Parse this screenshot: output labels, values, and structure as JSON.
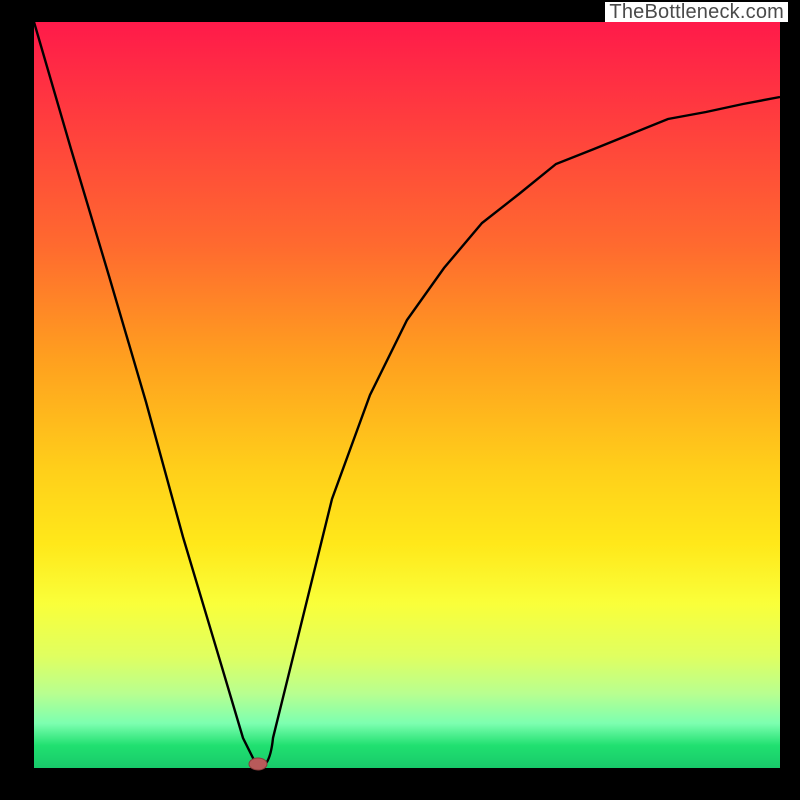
{
  "watermark": "TheBottleneck.com",
  "colors": {
    "frame": "#000000",
    "curve": "#000000",
    "marker": "#b85a5a",
    "gradient_top": "#ff1a4a",
    "gradient_bottom": "#18c96a"
  },
  "chart_data": {
    "type": "line",
    "title": "",
    "xlabel": "",
    "ylabel": "",
    "xlim": [
      0,
      100
    ],
    "ylim": [
      0,
      100
    ],
    "grid": false,
    "legend": false,
    "series": [
      {
        "name": "bottleneck-curve",
        "x": [
          0,
          5,
          10,
          15,
          20,
          25,
          28,
          30,
          32,
          35,
          40,
          45,
          50,
          55,
          60,
          65,
          70,
          75,
          80,
          85,
          90,
          95,
          100
        ],
        "y": [
          100,
          83,
          66,
          49,
          31,
          14,
          4,
          0,
          4,
          16,
          36,
          50,
          60,
          67,
          73,
          77,
          81,
          83,
          85,
          87,
          88,
          89,
          90
        ]
      }
    ],
    "markers": [
      {
        "name": "minimum-point",
        "x": 30,
        "y": 0
      }
    ]
  }
}
